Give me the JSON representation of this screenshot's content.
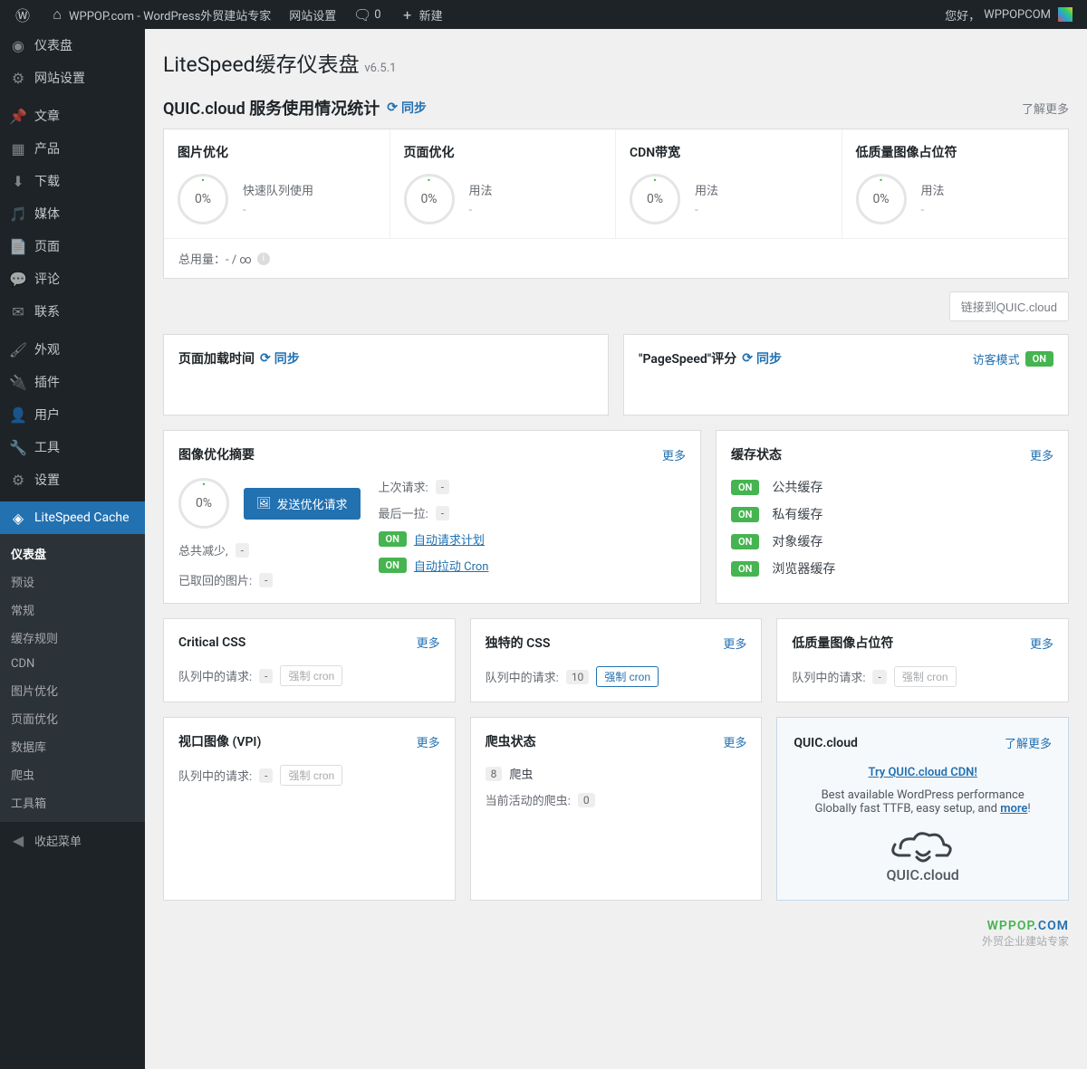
{
  "adminbar": {
    "site_name": "WPPOP.com - WordPress外贸建站专家",
    "site_settings": "网站设置",
    "comments": "0",
    "new": "新建",
    "greeting": "您好，",
    "user": "WPPOPCOM"
  },
  "sidebar": {
    "items": [
      {
        "label": "仪表盘",
        "icon": "dashboard"
      },
      {
        "label": "网站设置",
        "icon": "gear"
      },
      {
        "label": "文章",
        "icon": "pin"
      },
      {
        "label": "产品",
        "icon": "grid"
      },
      {
        "label": "下载",
        "icon": "download"
      },
      {
        "label": "媒体",
        "icon": "media"
      },
      {
        "label": "页面",
        "icon": "page"
      },
      {
        "label": "评论",
        "icon": "comment"
      },
      {
        "label": "联系",
        "icon": "mail"
      },
      {
        "label": "外观",
        "icon": "brush"
      },
      {
        "label": "插件",
        "icon": "plug"
      },
      {
        "label": "用户",
        "icon": "user"
      },
      {
        "label": "工具",
        "icon": "wrench"
      },
      {
        "label": "设置",
        "icon": "sliders"
      },
      {
        "label": "LiteSpeed Cache",
        "icon": "diamond",
        "current": true
      }
    ],
    "submenu": [
      "仪表盘",
      "预设",
      "常规",
      "缓存规则",
      "CDN",
      "图片优化",
      "页面优化",
      "数据库",
      "爬虫",
      "工具箱"
    ],
    "submenu_current": "仪表盘",
    "collapse": "收起菜单"
  },
  "page": {
    "title": "LiteSpeed缓存仪表盘",
    "version": "v6.5.1"
  },
  "quic_stats": {
    "heading": "QUIC.cloud 服务使用情况统计",
    "sync": "同步",
    "learn_more": "了解更多",
    "cells": [
      {
        "title": "图片优化",
        "pct": "0%",
        "meta": "快速队列使用",
        "sub": "-"
      },
      {
        "title": "页面优化",
        "pct": "0%",
        "meta": "用法",
        "sub": "-"
      },
      {
        "title": "CDN带宽",
        "pct": "0%",
        "meta": "用法",
        "sub": "-"
      },
      {
        "title": "低质量图像占位符",
        "pct": "0%",
        "meta": "用法",
        "sub": "-"
      }
    ],
    "total": "总用量：- / ∞",
    "link_btn": "链接到QUIC.cloud"
  },
  "load_time": {
    "title": "页面加载时间",
    "sync": "同步"
  },
  "pagespeed": {
    "title": "\"PageSpeed\"评分",
    "sync": "同步",
    "guest": "访客模式",
    "on": "ON"
  },
  "img_opt": {
    "title": "图像优化摘要",
    "more": "更多",
    "pct": "0%",
    "send_btn": "发送优化请求",
    "total_reduce": "总共减少,",
    "total_reduce_val": "-",
    "retrieved": "已取回的图片:",
    "retrieved_val": "-",
    "last_request": "上次请求:",
    "last_request_val": "-",
    "last_pull": "最后一拉:",
    "last_pull_val": "-",
    "auto_request": "自动请求计划",
    "auto_cron": "自动拉动 Cron",
    "on": "ON"
  },
  "cache_status": {
    "title": "缓存状态",
    "more": "更多",
    "on": "ON",
    "items": [
      "公共缓存",
      "私有缓存",
      "对象缓存",
      "浏览器缓存"
    ]
  },
  "ccss": {
    "title": "Critical CSS",
    "more": "更多",
    "queue_label": "队列中的请求:",
    "queue_val": "-",
    "force": "强制 cron"
  },
  "ucss": {
    "title": "独特的 CSS",
    "more": "更多",
    "queue_label": "队列中的请求:",
    "queue_val": "10",
    "force": "强制 cron"
  },
  "lqip": {
    "title": "低质量图像占位符",
    "more": "更多",
    "queue_label": "队列中的请求:",
    "queue_val": "-",
    "force": "强制 cron"
  },
  "vpi": {
    "title": "视口图像 (VPI)",
    "more": "更多",
    "queue_label": "队列中的请求:",
    "queue_val": "-",
    "force": "强制 cron"
  },
  "crawler": {
    "title": "爬虫状态",
    "more": "更多",
    "count": "8",
    "label": "爬虫",
    "active_label": "当前活动的爬虫:",
    "active_val": "0"
  },
  "quic_card": {
    "title": "QUIC.cloud",
    "more": "了解更多",
    "try": "Try QUIC.cloud CDN!",
    "line1": "Best available WordPress performance",
    "line2_a": "Globally fast TTFB, easy setup, and ",
    "line2_b": "more",
    "line2_c": "!",
    "logo_text": "QUIC.cloud"
  },
  "footer": {
    "brand_a": "WPPOP",
    "brand_b": ".COM",
    "sub": "外贸企业建站专家"
  }
}
